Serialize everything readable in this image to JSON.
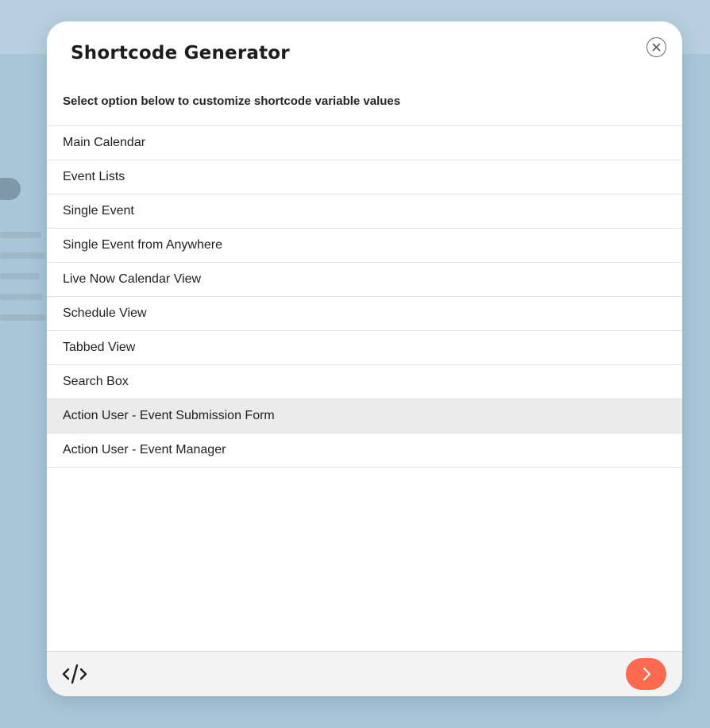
{
  "modal": {
    "title": "Shortcode Generator",
    "subtitle": "Select option below to customize shortcode variable values",
    "close_icon": "close-icon"
  },
  "options": [
    {
      "label": "Main Calendar"
    },
    {
      "label": "Event Lists"
    },
    {
      "label": "Single Event"
    },
    {
      "label": "Single Event from Anywhere"
    },
    {
      "label": "Live Now Calendar View"
    },
    {
      "label": "Schedule View"
    },
    {
      "label": "Tabbed View"
    },
    {
      "label": "Search Box"
    },
    {
      "label": "Action User - Event Submission Form",
      "highlighted": true
    },
    {
      "label": "Action User - Event Manager"
    }
  ],
  "footer": {
    "code_icon": "code-icon",
    "next_icon": "chevron-right-icon"
  },
  "colors": {
    "accent": "#fd6a4f",
    "overlay": "#a9c6d9",
    "highlight_row": "#ebebeb"
  }
}
